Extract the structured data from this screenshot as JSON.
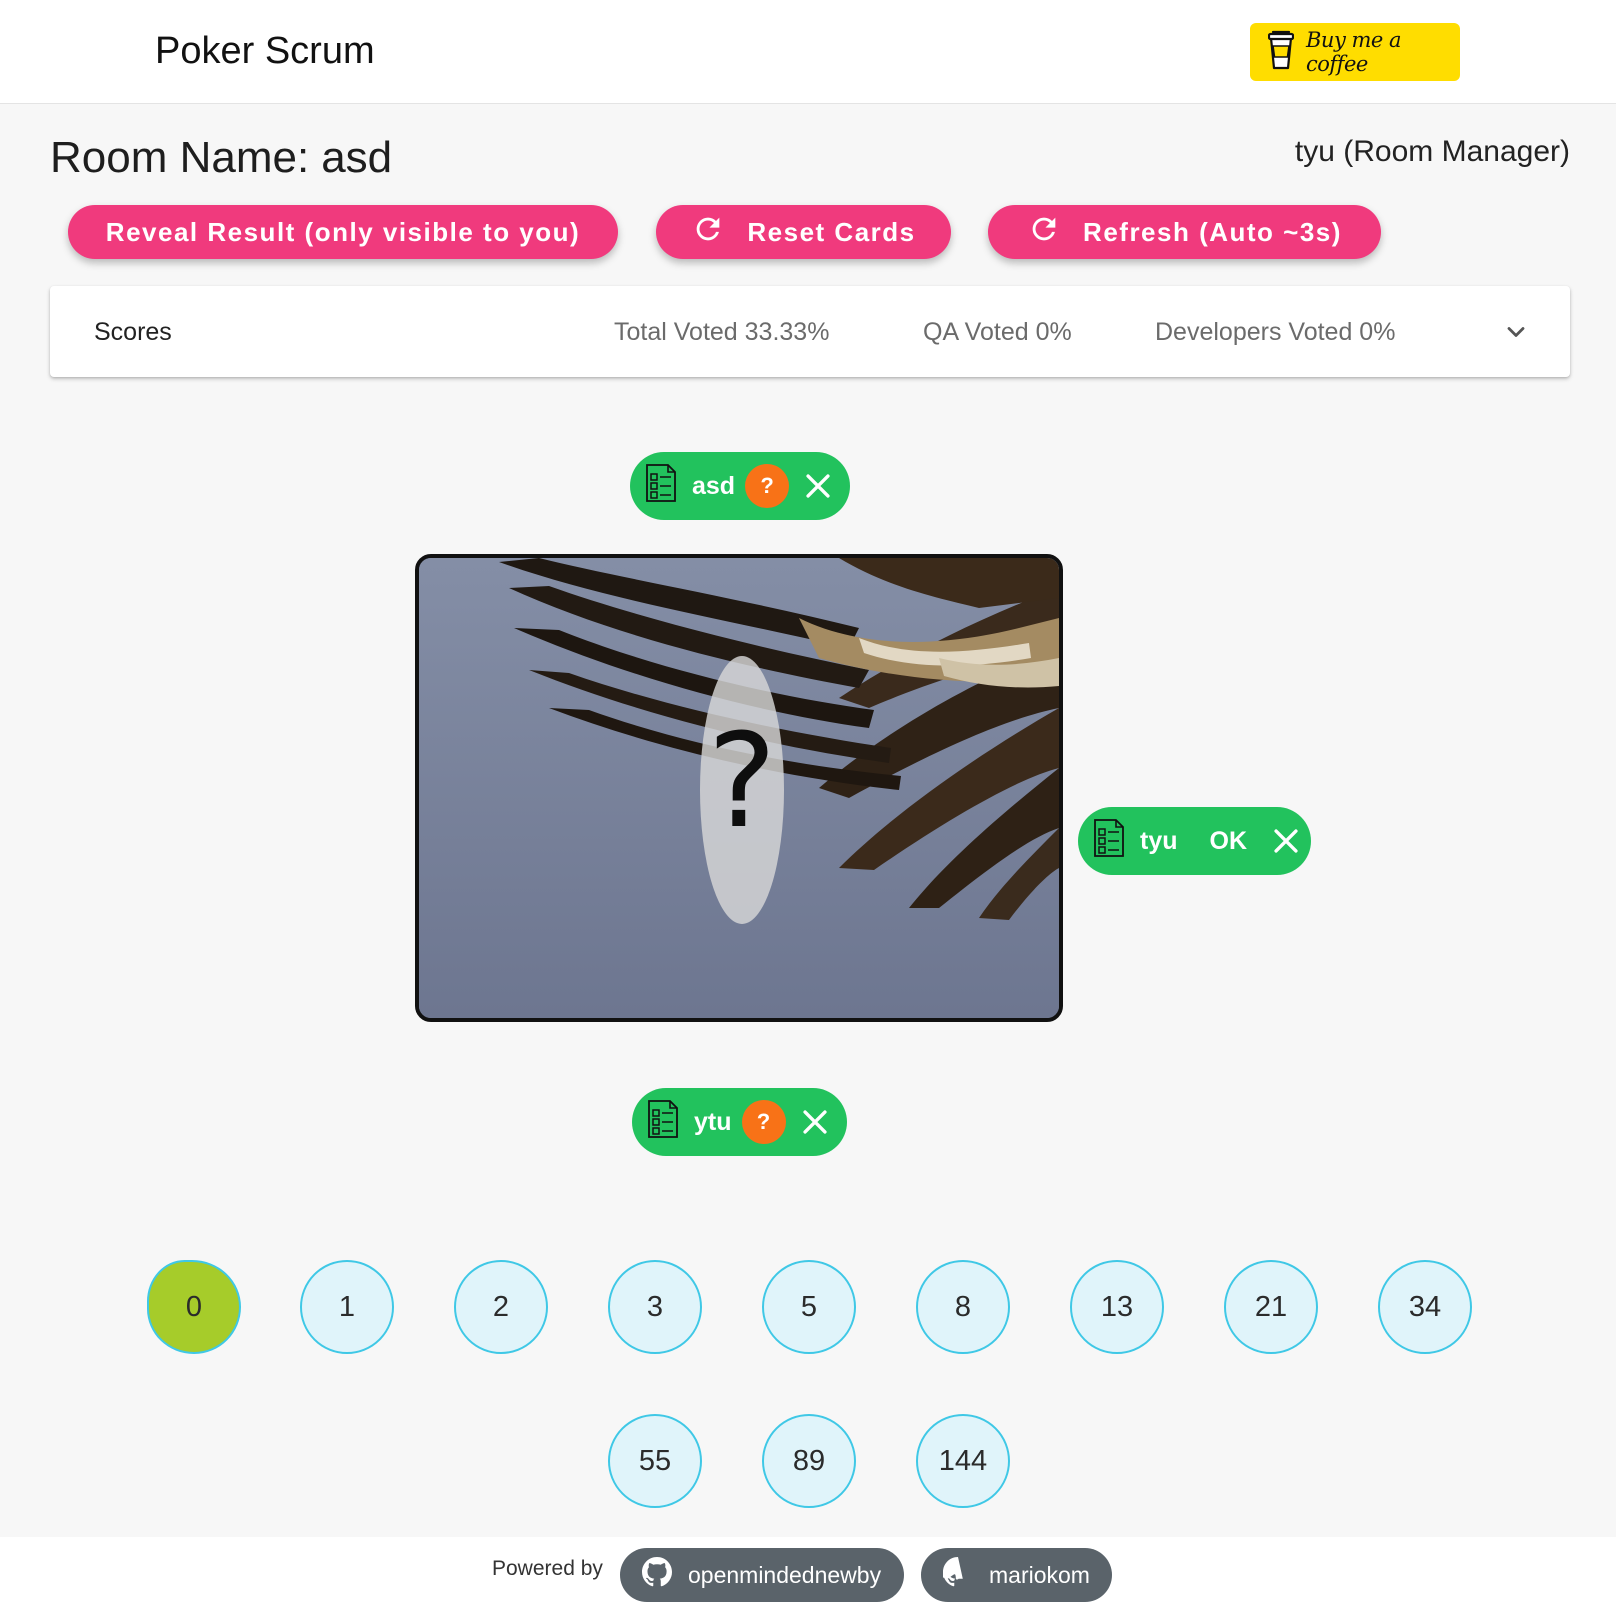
{
  "header": {
    "title": "Poker Scrum",
    "coffee_label": "Buy me a coffee",
    "coffee_icon": "coffee-cup-icon",
    "coffee_color": "#ffdd00"
  },
  "room": {
    "label": "Room Name:",
    "name": "asd",
    "user_role": "tyu (Room Manager)"
  },
  "actions": {
    "reveal_label": "Reveal Result (only visible to you)",
    "reset_label": "Reset Cards",
    "refresh_label": "Refresh (Auto ~3s)",
    "accent_color": "#f03a7d"
  },
  "scores": {
    "label": "Scores",
    "total_voted": "Total Voted 33.33%",
    "qa_voted": "QA Voted 0%",
    "developers_voted": "Developers Voted 0%",
    "expanded": false
  },
  "players": [
    {
      "name": "asd",
      "status": "?",
      "voted": false,
      "role_icon": "checklist-icon"
    },
    {
      "name": "tyu",
      "status": "OK",
      "voted": true,
      "role_icon": "checklist-icon"
    },
    {
      "name": "ytu",
      "status": "?",
      "voted": false,
      "role_icon": "checklist-icon"
    }
  ],
  "table": {
    "hidden_symbol": "?"
  },
  "cards": [
    {
      "value": "0",
      "selected": true
    },
    {
      "value": "1",
      "selected": false
    },
    {
      "value": "2",
      "selected": false
    },
    {
      "value": "3",
      "selected": false
    },
    {
      "value": "5",
      "selected": false
    },
    {
      "value": "8",
      "selected": false
    },
    {
      "value": "13",
      "selected": false
    },
    {
      "value": "21",
      "selected": false
    },
    {
      "value": "34",
      "selected": false
    },
    {
      "value": "55",
      "selected": false
    },
    {
      "value": "89",
      "selected": false
    },
    {
      "value": "144",
      "selected": false
    }
  ],
  "footer": {
    "powered_by": "Powered by",
    "links": [
      {
        "label": "openmindednewby",
        "icon": "github-icon"
      },
      {
        "label": "mariokom",
        "icon": "github-icon"
      }
    ]
  },
  "colors": {
    "chip_green": "#22c25d",
    "status_orange": "#f87217",
    "card_fill": "#e0f4fa",
    "card_border": "#3fc8e6",
    "card_selected": "#a6cc2a"
  }
}
